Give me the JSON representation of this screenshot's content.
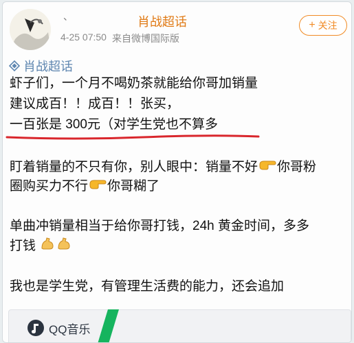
{
  "header": {
    "account_name": "肖战超话",
    "tiny_mark": "、",
    "timestamp": "4-25 07:50",
    "source": "来自微博国际版",
    "follow_label": "关注",
    "follow_icon": "plus-icon"
  },
  "post": {
    "topic_tag": "肖战超话",
    "lines": [
      "虾子们，一个月不喝奶茶就能给你哥加销量",
      "建议成百！！成百！！张买，",
      "一百张是 300元（对学生党也不算多",
      "盯着销量的不只有你，别人眼中：销量不好",
      "你哥粉",
      "圈购买力不行",
      "你哥糊了",
      "单曲冲销量相当于给你哥打钱，24h 黄金时间，多多",
      "打钱",
      "我也是学生党，有管理生活费的能力，还会追加"
    ]
  },
  "music_card": {
    "brand": "QQ音乐"
  },
  "colors": {
    "accent": "#e07a15",
    "topic": "#5e86b0",
    "underline": "#d9262c"
  }
}
